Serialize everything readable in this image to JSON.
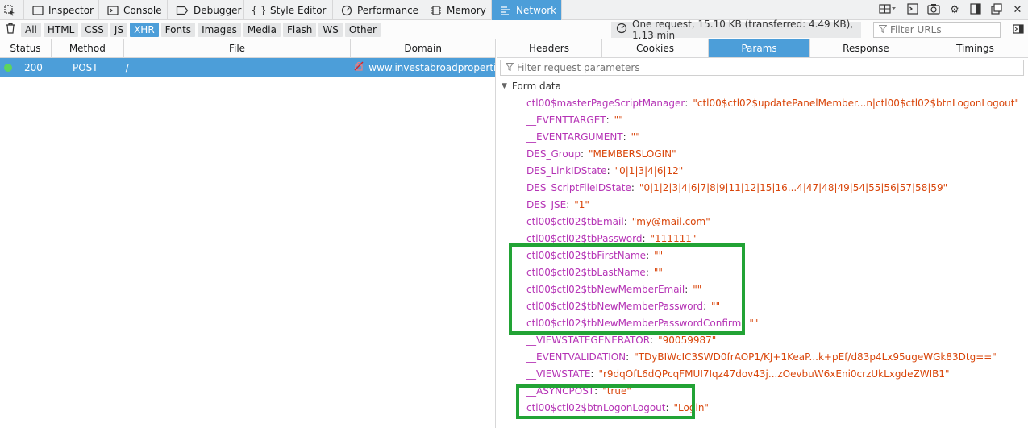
{
  "toolbar": {
    "tabs": [
      {
        "label": "Inspector",
        "icon": "inspector-icon"
      },
      {
        "label": "Console",
        "icon": "console-icon"
      },
      {
        "label": "Debugger",
        "icon": "debugger-icon"
      },
      {
        "label": "Style Editor",
        "icon": "style-editor-icon"
      },
      {
        "label": "Performance",
        "icon": "performance-icon"
      },
      {
        "label": "Memory",
        "icon": "memory-icon"
      },
      {
        "label": "Network",
        "icon": "network-icon"
      }
    ],
    "selected_tab": "Network"
  },
  "filter_bar": {
    "types": [
      "All",
      "HTML",
      "CSS",
      "JS",
      "XHR",
      "Fonts",
      "Images",
      "Media",
      "Flash",
      "WS",
      "Other"
    ],
    "active_type": "XHR",
    "summary": "One request, 15.10 KB (transferred: 4.49 KB), 1.13 min",
    "filter_urls_placeholder": "Filter URLs"
  },
  "request_list": {
    "columns": [
      "Status",
      "Method",
      "File",
      "Domain"
    ],
    "rows": [
      {
        "status": "200",
        "method": "POST",
        "file": "/",
        "domain": "www.investabroadproperti..."
      }
    ]
  },
  "details": {
    "tabs": [
      "Headers",
      "Cookies",
      "Params",
      "Response",
      "Timings"
    ],
    "selected_tab": "Params",
    "filter_placeholder": "Filter request parameters",
    "section_title": "Form data",
    "params": [
      {
        "key": "ctl00$masterPageScriptManager",
        "value": "\"ctl00$ctl02$updatePanelMember...n|ctl00$ctl02$btnLogonLogout\""
      },
      {
        "key": "__EVENTTARGET",
        "value": "\"\""
      },
      {
        "key": "__EVENTARGUMENT",
        "value": "\"\""
      },
      {
        "key": "DES_Group",
        "value": "\"MEMBERSLOGIN\""
      },
      {
        "key": "DES_LinkIDState",
        "value": "\"0|1|3|4|6|12\""
      },
      {
        "key": "DES_ScriptFileIDState",
        "value": "\"0|1|2|3|4|6|7|8|9|11|12|15|16...4|47|48|49|54|55|56|57|58|59\""
      },
      {
        "key": "DES_JSE",
        "value": "\"1\""
      },
      {
        "key": "ctl00$ctl02$tbEmail",
        "value": "\"my@mail.com\""
      },
      {
        "key": "ctl00$ctl02$tbPassword",
        "value": "\"111111\""
      },
      {
        "key": "ctl00$ctl02$tbFirstName",
        "value": "\"\""
      },
      {
        "key": "ctl00$ctl02$tbLastName",
        "value": "\"\""
      },
      {
        "key": "ctl00$ctl02$tbNewMemberEmail",
        "value": "\"\""
      },
      {
        "key": "ctl00$ctl02$tbNewMemberPassword",
        "value": "\"\""
      },
      {
        "key": "ctl00$ctl02$tbNewMemberPasswordConfirm",
        "value": "\"\""
      },
      {
        "key": "__VIEWSTATEGENERATOR",
        "value": "\"90059987\""
      },
      {
        "key": "__EVENTVALIDATION",
        "value": "\"TDyBIWcIC3SWD0frAOP1/KJ+1KeaP...k+pEf/d83p4Lx95ugeWGk83Dtg==\""
      },
      {
        "key": "__VIEWSTATE",
        "value": "\"r9dqOfL6dQPcqFMUI7Iqz47dov43j...zOevbuW6xEni0crzUkLxgdeZWIB1\""
      },
      {
        "key": "__ASYNCPOST",
        "value": "\"true\""
      },
      {
        "key": "ctl00$ctl02$btnLogonLogout",
        "value": "\"Login\""
      }
    ]
  },
  "colors": {
    "accent": "#4c9ed9",
    "param_key": "#b533b5",
    "param_value": "#d9460b",
    "highlight_box": "#22a335",
    "status_ok": "#5dd55d"
  }
}
